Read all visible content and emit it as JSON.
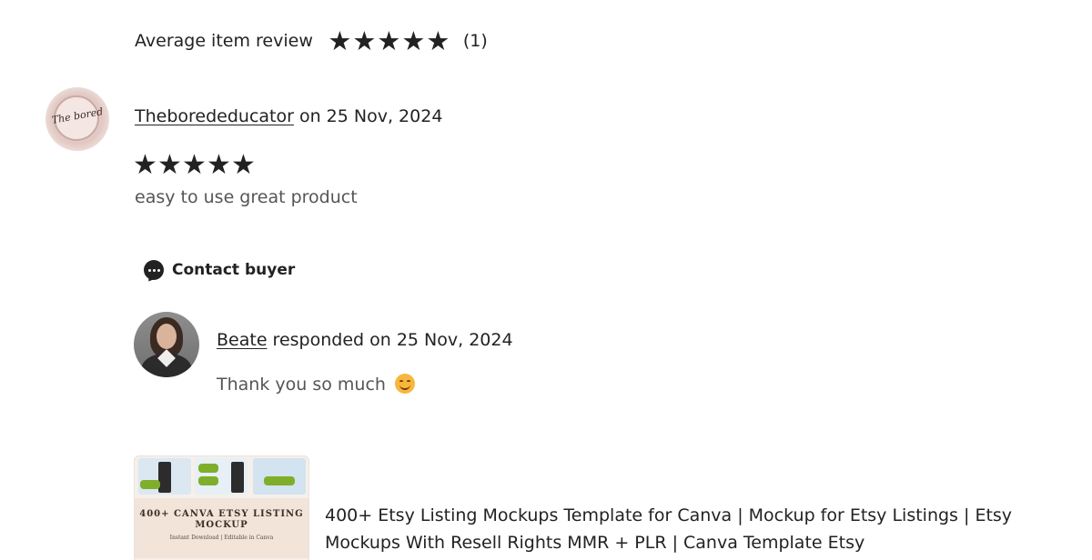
{
  "summary": {
    "label": "Average item review",
    "rating": 5,
    "max_rating": 5,
    "count_text": "(1)"
  },
  "review": {
    "reviewer_name": "Theborededucator",
    "date_text": " on 25 Nov, 2024",
    "rating": 5,
    "text": "easy to use great product",
    "avatar_text": "The bored"
  },
  "contact": {
    "label": "Contact buyer",
    "icon": "chat-bubble-icon"
  },
  "response": {
    "seller_name": "Beate",
    "date_text": " responded on 25 Nov, 2024",
    "text": "Thank you so much ",
    "emoji": "smiling-face-emoji"
  },
  "item": {
    "thumbnail_title": "400+ CANVA ETSY LISTING MOCKUP",
    "thumbnail_subtitle": "Instant Download | Editable in Canva",
    "title": "400+ Etsy Listing Mockups Template for Canva | Mockup for Etsy Listings | Etsy Mockups With Resell Rights MMR + PLR | Canva Template Etsy"
  },
  "colors": {
    "text": "#222222",
    "muted": "#555555",
    "star": "#222222"
  }
}
